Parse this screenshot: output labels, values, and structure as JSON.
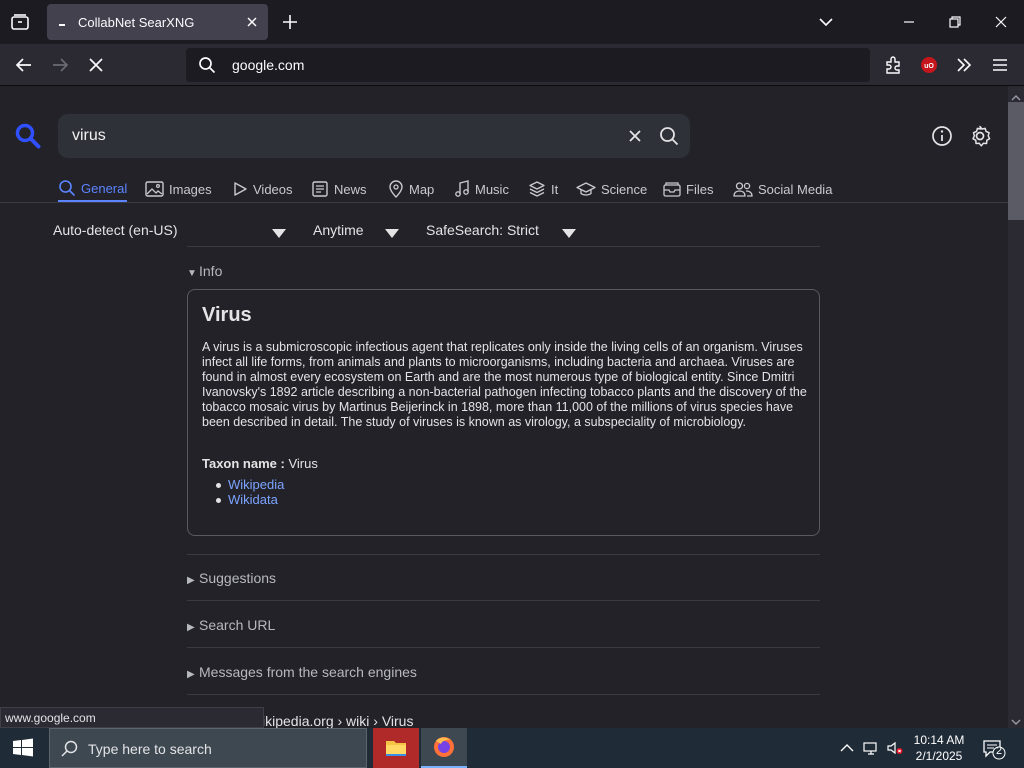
{
  "browser": {
    "tab_title": "CollabNet SearXNG",
    "url": "google.com"
  },
  "search": {
    "query": "virus"
  },
  "categories": [
    {
      "label": "General",
      "icon": "search-icon",
      "active": true
    },
    {
      "label": "Images",
      "icon": "image-icon"
    },
    {
      "label": "Videos",
      "icon": "play-icon"
    },
    {
      "label": "News",
      "icon": "newspaper-icon"
    },
    {
      "label": "Map",
      "icon": "map-pin-icon"
    },
    {
      "label": "Music",
      "icon": "music-note-icon"
    },
    {
      "label": "It",
      "icon": "layers-icon"
    },
    {
      "label": "Science",
      "icon": "school-icon"
    },
    {
      "label": "Files",
      "icon": "file-tray-icon"
    },
    {
      "label": "Social Media",
      "icon": "people-icon"
    }
  ],
  "filters": {
    "language": "Auto-detect (en-US)",
    "time": "Anytime",
    "safesearch": "SafeSearch: Strict"
  },
  "sections": {
    "info": "Info",
    "suggestions": "Suggestions",
    "search_url": "Search URL",
    "messages": "Messages from the search engines"
  },
  "infobox": {
    "title": "Virus",
    "description": " A virus is a submicroscopic infectious agent that replicates only inside the living cells of an organism. Viruses infect all life forms, from animals and plants to microorganisms, including bacteria and archaea. Viruses are found in almost every ecosystem on Earth and are the most numerous type of biological entity. Since Dmitri Ivanovsky's 1892 article describing a non-bacterial pathogen infecting tobacco plants and the discovery of the tobacco mosaic virus by Martinus Beijerinck in 1898, more than 11,000 of the millions of virus species have been described in detail. The study of viruses is known as virology, a subspeciality of microbiology.",
    "taxon_label": "Taxon name :",
    "taxon_value": "Virus",
    "links": [
      "Wikipedia",
      "Wikidata"
    ]
  },
  "result": {
    "url_breadcrumb": "ikipedia.org  › wiki › Virus"
  },
  "status_link": "www.google.com",
  "taskbar": {
    "search_placeholder": "Type here to search",
    "time": "10:14 AM",
    "date": "2/1/2025",
    "notification_count": "2"
  },
  "colors": {
    "accent": "#5c84ff",
    "link": "#7ca4ff",
    "page_bg": "#222228"
  }
}
